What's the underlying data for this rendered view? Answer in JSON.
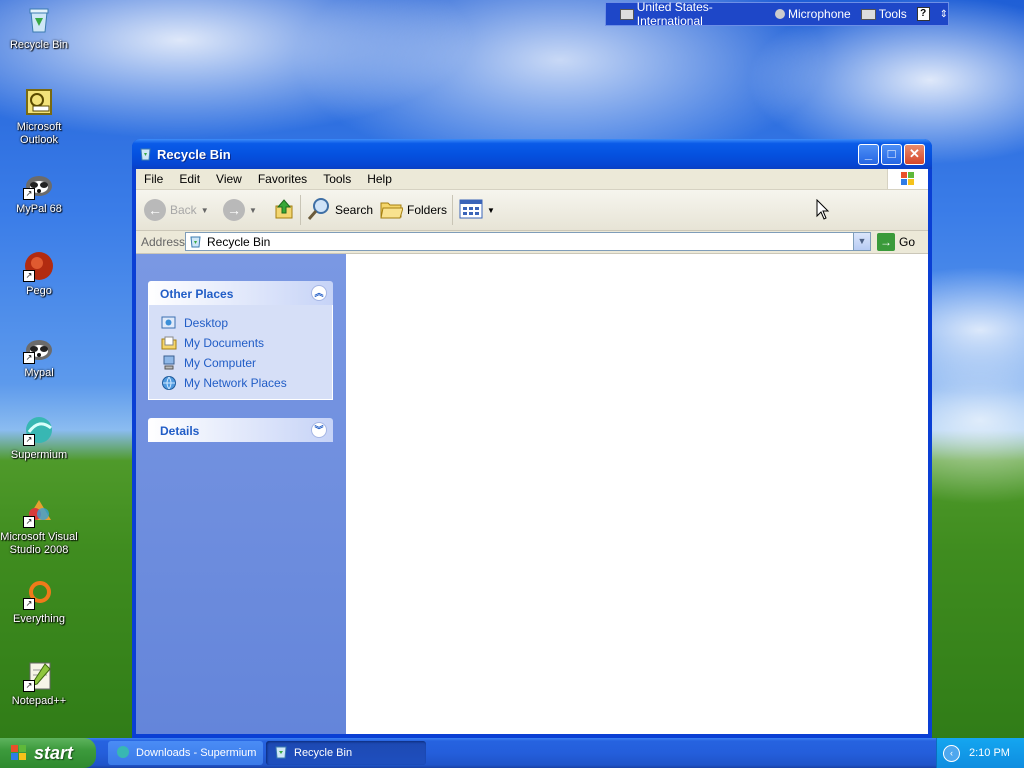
{
  "desktop": {
    "icons": [
      {
        "label": "Recycle Bin"
      },
      {
        "label": "Microsoft Outlook"
      },
      {
        "label": "MyPal 68"
      },
      {
        "label": "Pego"
      },
      {
        "label": "Mypal"
      },
      {
        "label": "Supermium"
      },
      {
        "label": "Microsoft Visual Studio 2008"
      },
      {
        "label": "Everything"
      },
      {
        "label": "Notepad++"
      }
    ]
  },
  "langbar": {
    "language": "United States-International",
    "microphone": "Microphone",
    "tools": "Tools",
    "help": "?"
  },
  "window": {
    "title": "Recycle Bin",
    "min": "_",
    "max": "□",
    "close": "✕",
    "menu": [
      "File",
      "Edit",
      "View",
      "Favorites",
      "Tools",
      "Help"
    ],
    "toolbar": {
      "back": "Back",
      "search": "Search",
      "folders": "Folders"
    },
    "address": {
      "label": "Address",
      "value": "Recycle Bin",
      "go": "Go"
    },
    "other_places": {
      "title": "Other Places",
      "items": [
        "Desktop",
        "My Documents",
        "My Computer",
        "My Network Places"
      ]
    },
    "details": {
      "title": "Details"
    }
  },
  "taskbar": {
    "start": "start",
    "tasks": [
      "Downloads - Supermium",
      "Recycle Bin"
    ],
    "clock": "2:10 PM"
  },
  "colors": {
    "title_blue": "#0552e0",
    "task_link": "#215dc6",
    "start_green": "#3c9a3c"
  }
}
